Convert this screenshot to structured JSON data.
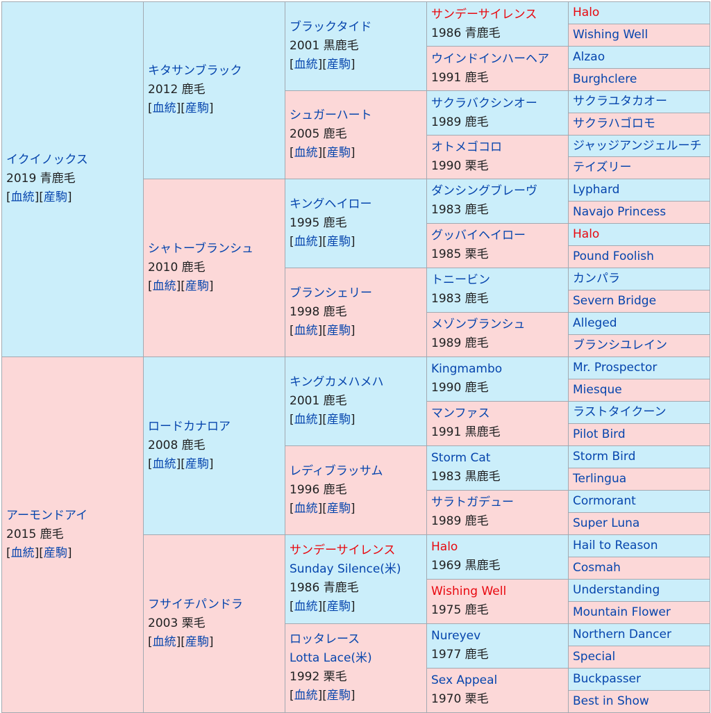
{
  "link_labels": {
    "bloodline": "血統",
    "progeny": "産駒"
  },
  "g1": [
    {
      "name": "イクイノックス",
      "info": "2019 青鹿毛"
    },
    {
      "name": "アーモンドアイ",
      "info": "2015 鹿毛"
    }
  ],
  "g2": [
    {
      "name": "キタサンブラック",
      "info": "2012 鹿毛"
    },
    {
      "name": "シャトーブランシュ",
      "info": "2010 鹿毛"
    },
    {
      "name": "ロードカナロア",
      "info": "2008 鹿毛"
    },
    {
      "name": "フサイチパンドラ",
      "info": "2003 栗毛"
    }
  ],
  "g3": [
    {
      "name": "ブラックタイド",
      "info": "2001 黒鹿毛"
    },
    {
      "name": "シュガーハート",
      "info": "2005 鹿毛"
    },
    {
      "name": "キングヘイロー",
      "info": "1995 鹿毛"
    },
    {
      "name": "ブランシェリー",
      "info": "1998 鹿毛"
    },
    {
      "name": "キングカメハメハ",
      "info": "2001 鹿毛"
    },
    {
      "name": "レディブラッサム",
      "info": "1996 鹿毛"
    },
    {
      "name": "サンデーサイレンス",
      "alt": "Sunday Silence(米)",
      "info": "1986 青鹿毛"
    },
    {
      "name": "ロッタレース",
      "alt": "Lotta Lace(米)",
      "info": "1992 栗毛"
    }
  ],
  "g4": [
    {
      "name": "サンデーサイレンス",
      "info": "1986 青鹿毛"
    },
    {
      "name": "ウインドインハーヘア",
      "info": "1991 鹿毛"
    },
    {
      "name": "サクラバクシンオー",
      "info": "1989 鹿毛"
    },
    {
      "name": "オトメゴコロ",
      "info": "1990 栗毛"
    },
    {
      "name": "ダンシングブレーヴ",
      "info": "1983 鹿毛"
    },
    {
      "name": "グッバイヘイロー",
      "info": "1985 栗毛"
    },
    {
      "name": "トニービン",
      "info": "1983 鹿毛"
    },
    {
      "name": "メゾンブランシュ",
      "info": "1989 鹿毛"
    },
    {
      "name": "Kingmambo",
      "info": "1990 鹿毛"
    },
    {
      "name": "マンファス",
      "info": "1991 黒鹿毛"
    },
    {
      "name": "Storm Cat",
      "info": "1983 黒鹿毛"
    },
    {
      "name": "サラトガデュー",
      "info": "1989 鹿毛"
    },
    {
      "name": "Halo",
      "info": "1969 黒鹿毛"
    },
    {
      "name": "Wishing Well",
      "info": "1975 鹿毛"
    },
    {
      "name": "Nureyev",
      "info": "1977 鹿毛"
    },
    {
      "name": "Sex Appeal",
      "info": "1970 栗毛"
    }
  ],
  "g5": [
    "Halo",
    "Wishing Well",
    "Alzao",
    "Burghclere",
    "サクラユタカオー",
    "サクラハゴロモ",
    "ジャッジアンジェルーチ",
    "テイズリー",
    "Lyphard",
    "Navajo Princess",
    "Halo",
    "Pound Foolish",
    "カンパラ",
    "Severn Bridge",
    "Alleged",
    "ブランシユレイン",
    "Mr. Prospector",
    "Miesque",
    "ラストタイクーン",
    "Pilot Bird",
    "Storm Bird",
    "Terlingua",
    "Cormorant",
    "Super Luna",
    "Hail to Reason",
    "Cosmah",
    "Understanding",
    "Mountain Flower",
    "Northern Dancer",
    "Special",
    "Buckpasser",
    "Best in Show"
  ],
  "highlight_color": "#e8080f"
}
